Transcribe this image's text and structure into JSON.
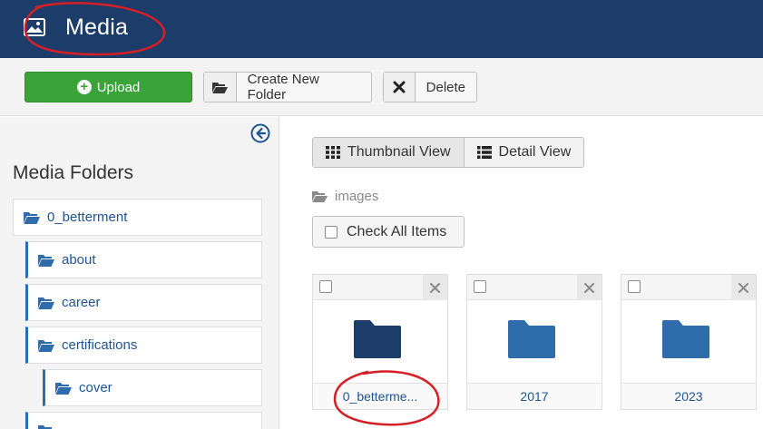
{
  "header": {
    "title": "Media",
    "icon": "image-icon"
  },
  "toolbar": {
    "upload_label": "Upload",
    "new_folder_label": "Create New Folder",
    "delete_label": "Delete"
  },
  "sidebar": {
    "title": "Media Folders",
    "items": [
      {
        "label": "0_betterment",
        "level": 0
      },
      {
        "label": "about",
        "level": 1
      },
      {
        "label": "career",
        "level": 1
      },
      {
        "label": "certifications",
        "level": 1
      },
      {
        "label": "cover",
        "level": 2
      }
    ]
  },
  "main": {
    "views": {
      "thumbnail_label": "Thumbnail View",
      "detail_label": "Detail View"
    },
    "breadcrumb": "images",
    "check_all_label": "Check All Items",
    "cards": [
      {
        "label": "0_betterme..."
      },
      {
        "label": "2017"
      },
      {
        "label": "2023"
      }
    ]
  },
  "colors": {
    "header_bg": "#1c3d6a",
    "upload_green": "#3aa33a",
    "link_blue": "#1f5493",
    "folder_dark": "#1c3d6a",
    "folder_blue": "#2e6cac",
    "annotation_red": "#d41f27"
  }
}
